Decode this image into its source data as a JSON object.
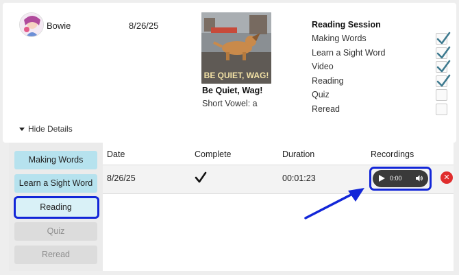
{
  "student": {
    "name": "Bowie",
    "date": "8/26/25"
  },
  "book": {
    "title": "Be Quiet, Wag!",
    "skill": "Short Vowel: a",
    "cover_text": "BE QUIET, WAG!"
  },
  "session": {
    "heading": "Reading Session",
    "items": [
      {
        "label": "Making Words",
        "checked": true
      },
      {
        "label": "Learn a Sight Word",
        "checked": true
      },
      {
        "label": "Video",
        "checked": true
      },
      {
        "label": "Reading",
        "checked": true
      },
      {
        "label": "Quiz",
        "checked": false
      },
      {
        "label": "Reread",
        "checked": false
      }
    ]
  },
  "toggle": {
    "label": "Hide Details"
  },
  "sidebar": {
    "items": [
      {
        "label": "Making Words",
        "state": "active"
      },
      {
        "label": "Learn a Sight Word",
        "state": "active"
      },
      {
        "label": "Reading",
        "state": "selected"
      },
      {
        "label": "Quiz",
        "state": "disabled"
      },
      {
        "label": "Reread",
        "state": "disabled"
      }
    ]
  },
  "table": {
    "headers": {
      "date": "Date",
      "complete": "Complete",
      "duration": "Duration",
      "recordings": "Recordings"
    },
    "rows": [
      {
        "date": "8/26/25",
        "complete": true,
        "duration": "00:01:23",
        "recording_time": "0:00"
      }
    ]
  },
  "colors": {
    "highlight": "#1226d8",
    "sidebar_active": "#b6e2ee",
    "delete": "#e02d2d",
    "check": "#3e7a8f"
  },
  "icons": {
    "play": "play-icon",
    "volume": "volume-icon",
    "delete": "close-icon",
    "check": "checkmark-icon",
    "caret": "caret-down-icon"
  }
}
